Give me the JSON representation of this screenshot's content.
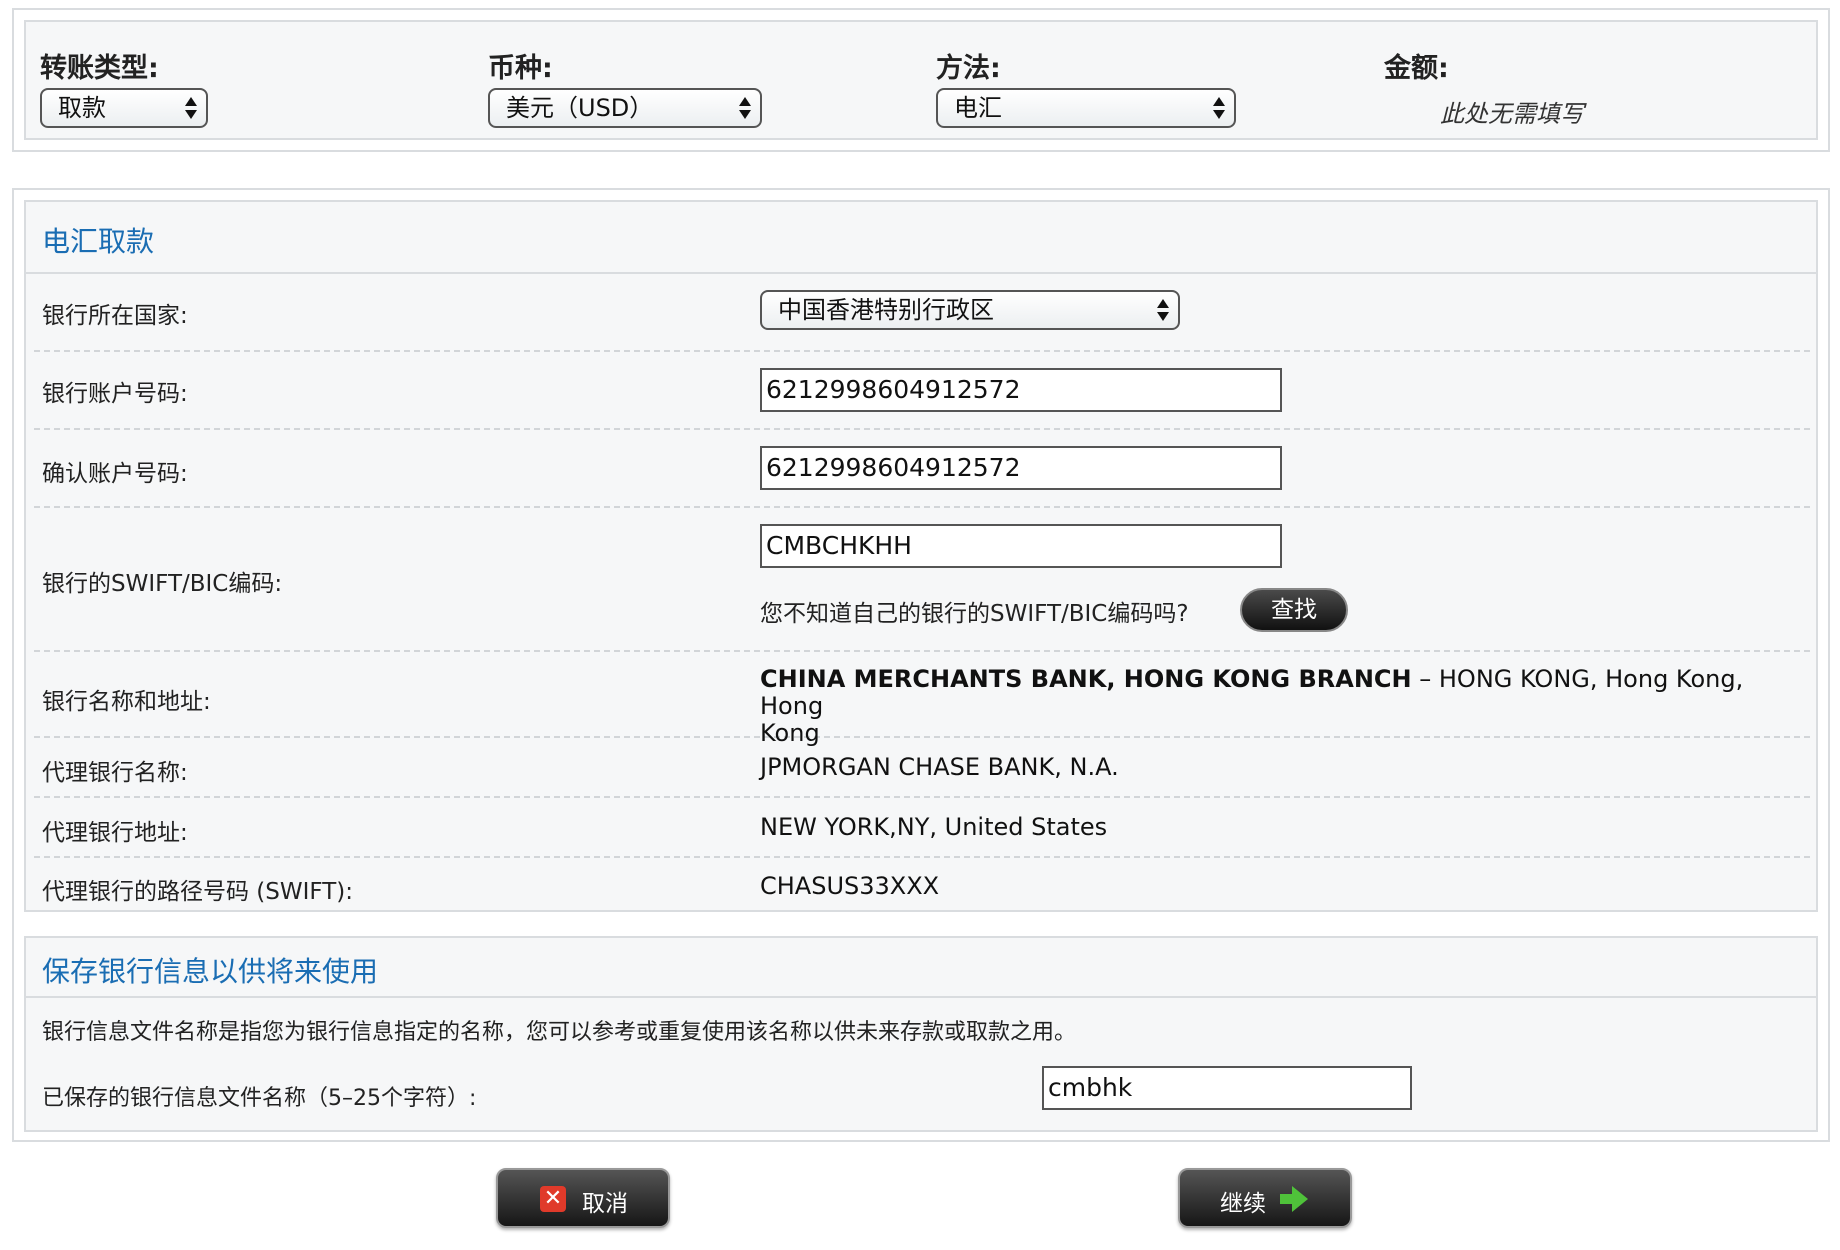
{
  "filters": {
    "transfer_type": {
      "label": "转账类型:",
      "value": "取款"
    },
    "currency": {
      "label": "币种:",
      "value": "美元（USD）"
    },
    "method": {
      "label": "方法:",
      "value": "电汇"
    },
    "amount": {
      "label": "金额:",
      "note": "此处无需填写"
    }
  },
  "wire": {
    "title": "电汇取款",
    "country": {
      "label": "银行所在国家:",
      "value": "中国香港特别行政区"
    },
    "account": {
      "label": "银行账户号码:",
      "value": "6212998604912572"
    },
    "confirm_account": {
      "label": "确认账户号码:",
      "value": "6212998604912572"
    },
    "swift": {
      "label": "银行的SWIFT/BIC编码:",
      "value": "CMBCHKHH",
      "hint": "您不知道自己的银行的SWIFT/BIC编码吗?",
      "lookup_button": "查找"
    },
    "bank_name": {
      "label": "银行名称和地址:",
      "name": "CHINA MERCHANTS BANK, HONG KONG BRANCH",
      "address_line1": " – HONG KONG, Hong Kong, Hong",
      "address_line2": "Kong"
    },
    "intermediary_name": {
      "label": "代理银行名称:",
      "value": "JPMORGAN CHASE BANK, N.A."
    },
    "intermediary_address": {
      "label": "代理银行地址:",
      "value": "NEW YORK,NY, United States"
    },
    "intermediary_swift": {
      "label": "代理银行的路径号码 (SWIFT):",
      "value": "CHASUS33XXX"
    }
  },
  "save": {
    "title": "保存银行信息以供将来使用",
    "description": "银行信息文件名称是指您为银行信息指定的名称，您可以参考或重复使用该名称以供未来存款或取款之用。",
    "profile_label": "已保存的银行信息文件名称（5–25个字符）:",
    "profile_value": "cmbhk"
  },
  "buttons": {
    "cancel": "取消",
    "continue": "继续"
  },
  "colors": {
    "section_title": "#1a6db3",
    "cancel_icon": "#e03a2a",
    "continue_arrow": "#4fc23a"
  }
}
